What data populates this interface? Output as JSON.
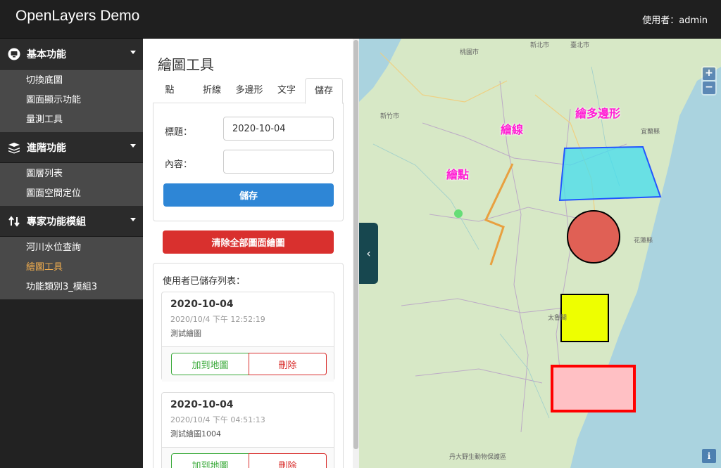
{
  "app": {
    "title": "OpenLayers Demo",
    "user": "使用者：admin"
  },
  "sidebar": {
    "groups": [
      {
        "label": "基本功能",
        "icon": "monitor-icon",
        "items": [
          "切換底圖",
          "圖面顯示功能",
          "量測工具"
        ]
      },
      {
        "label": "進階功能",
        "icon": "layers-icon",
        "items": [
          "圖層列表",
          "圖面空間定位"
        ]
      },
      {
        "label": "專家功能模組",
        "icon": "swap-arrows-icon",
        "items": [
          "河川水位查詢",
          "繪圖工具",
          "功能類別3_模組3"
        ]
      }
    ],
    "active_item": "繪圖工具",
    "active_color": "#f0ad4e"
  },
  "panel": {
    "title": "繪圖工具",
    "tabs": [
      "點",
      "折線",
      "多邊形",
      "文字",
      "儲存"
    ],
    "active_tab": "儲存",
    "form": {
      "title_label": "標題：",
      "title_value": "2020-10-04",
      "content_label": "內容：",
      "content_value": "",
      "save_button": "儲存"
    },
    "clear_button": "清除全部圖面繪圖",
    "saved_list_title": "使用者已儲存列表：",
    "saved_items": [
      {
        "title": "2020-10-04",
        "time": "2020/10/4 下午 12:52:19",
        "content": "測試繪圖",
        "add_button": "加到地圖",
        "delete_button": "刪除"
      },
      {
        "title": "2020-10-04",
        "time": "2020/10/4 下午 04:51:13",
        "content": "測試繪圖1004",
        "add_button": "加到地圖",
        "delete_button": "刪除"
      }
    ]
  },
  "map": {
    "labels": {
      "point": "繪點",
      "line": "繪線",
      "polygon": "繪多邊形"
    },
    "places": [
      "桃園市",
      "新北市",
      "新竹市",
      "臺北市",
      "宜蘭縣",
      "花蓮縣",
      "太魯閣",
      "丹大野生動物保護區"
    ],
    "zoom_in": "+",
    "zoom_out": "−",
    "info": "i",
    "collapse": "‹",
    "colors": {
      "land": "#d7e8c6",
      "sea": "#aad3df",
      "label": "#ff1fd3",
      "point": "#66dd77",
      "line": "#e8a040",
      "polygon_fill": "#44ddee",
      "polygon_stroke": "#2255ff",
      "circle_fill": "#e06055",
      "square_fill": "#eeff00",
      "rect_fill": "#ffc0c4",
      "rect_stroke": "#ff0000"
    }
  }
}
